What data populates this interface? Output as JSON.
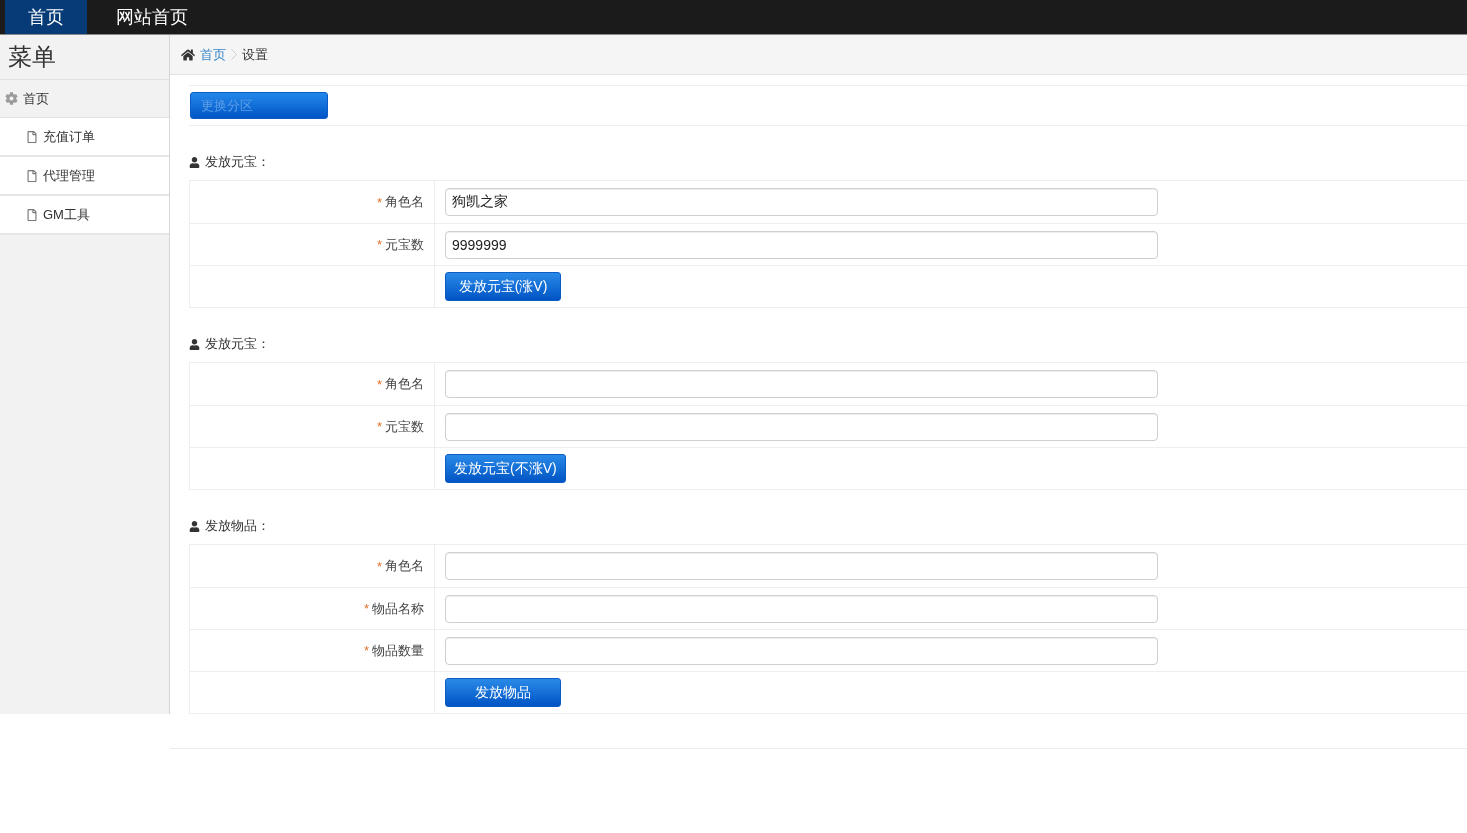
{
  "top_nav": {
    "tabs": [
      {
        "label": "首页",
        "selected": true
      },
      {
        "label": "网站首页",
        "selected": false
      }
    ]
  },
  "sidebar": {
    "title": "菜单",
    "items": [
      {
        "label": "首页",
        "children": [
          {
            "label": "充值订单"
          },
          {
            "label": "代理管理"
          },
          {
            "label": "GM工具"
          }
        ]
      }
    ]
  },
  "breadcrumb": [
    {
      "label": "首页",
      "kind": "link"
    },
    {
      "label": "设置",
      "kind": "current"
    }
  ],
  "toolbar": {
    "button": {
      "label": "更换分区",
      "disabled": true
    }
  },
  "sections": [
    {
      "title": "发放元宝：",
      "fields": [
        {
          "marker": "*",
          "label": "角色名",
          "value": "狗凯之家"
        },
        {
          "marker": "*",
          "label": "元宝数",
          "value": "9999999"
        }
      ],
      "button": "发放元宝(涨V)"
    },
    {
      "title": "发放元宝：",
      "fields": [
        {
          "marker": "*",
          "label": "角色名"
        },
        {
          "marker": "*",
          "label": "元宝数"
        }
      ],
      "button": "发放元宝(不涨V)"
    },
    {
      "title": "发放物品：",
      "fields": [
        {
          "marker": "*",
          "label": "角色名"
        },
        {
          "marker": "*",
          "label": "物品名称"
        },
        {
          "marker": "*",
          "label": "物品数量"
        }
      ],
      "button": "发放物品"
    }
  ]
}
